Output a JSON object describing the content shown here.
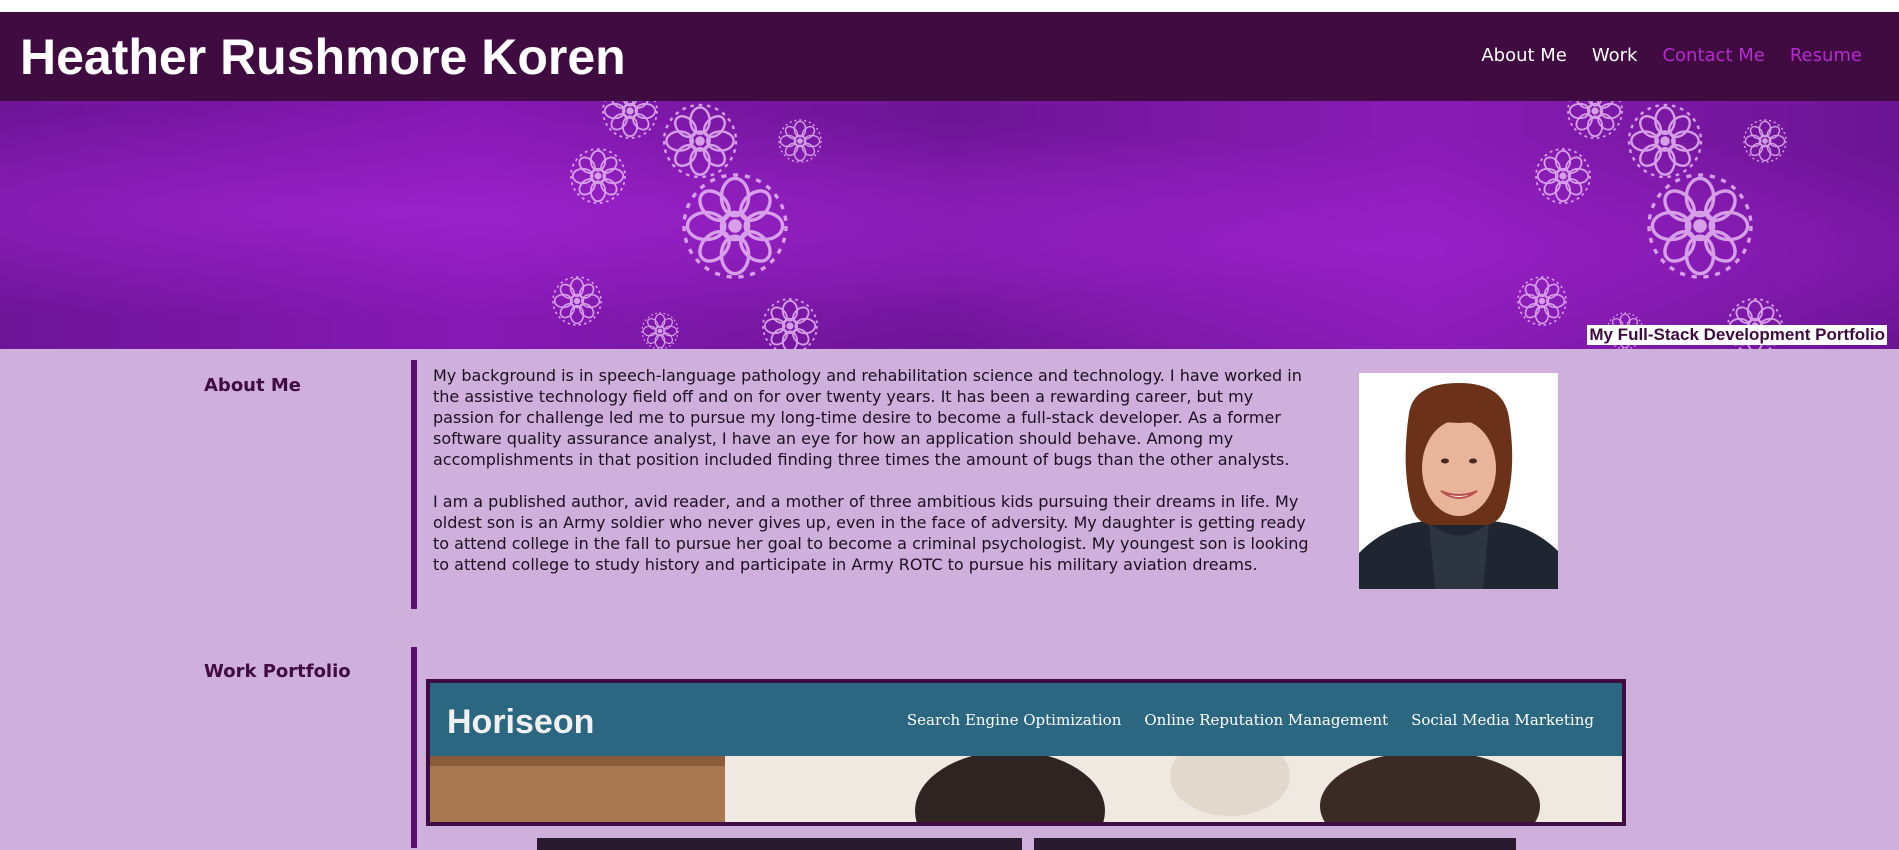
{
  "site": {
    "title": "Heather Rushmore Koren"
  },
  "nav": {
    "items": [
      {
        "label": "About Me"
      },
      {
        "label": "Work"
      },
      {
        "label": "Contact Me"
      },
      {
        "label": "Resume"
      }
    ]
  },
  "hero": {
    "tagline": "My Full-Stack Development Portfolio"
  },
  "about": {
    "heading": "About Me",
    "paragraphs": [
      "My background is in speech-language pathology and rehabilitation science and technology. I have worked in the assistive technology field off and on for over twenty years. It has been a rewarding career, but my passion for challenge led me to pursue my long-time desire to become a full-stack developer. As a former software quality assurance analyst, I have an eye for how an application should behave. Among my accomplishments in that position included finding three times the amount of bugs than the other analysts.",
      "I am a published author, avid reader, and a mother of three ambitious kids pursuing their dreams in life. My oldest son is an Army soldier who never gives up, even in the face of adversity. My daughter is getting ready to attend college in the fall to pursue her goal to become a criminal psychologist. My youngest son is looking to attend college to study history and participate in Army ROTC to pursue his military aviation dreams."
    ]
  },
  "work": {
    "heading": "Work Portfolio",
    "featured": {
      "logo": "Horiseon",
      "nav": [
        "Search Engine Optimization",
        "Online Reputation Management",
        "Social Media Marketing"
      ]
    }
  },
  "colors": {
    "header_bg": "#400b41",
    "page_bg": "#cfafdc",
    "accent": "#b72ad0",
    "bar": "#5c0e6e"
  }
}
